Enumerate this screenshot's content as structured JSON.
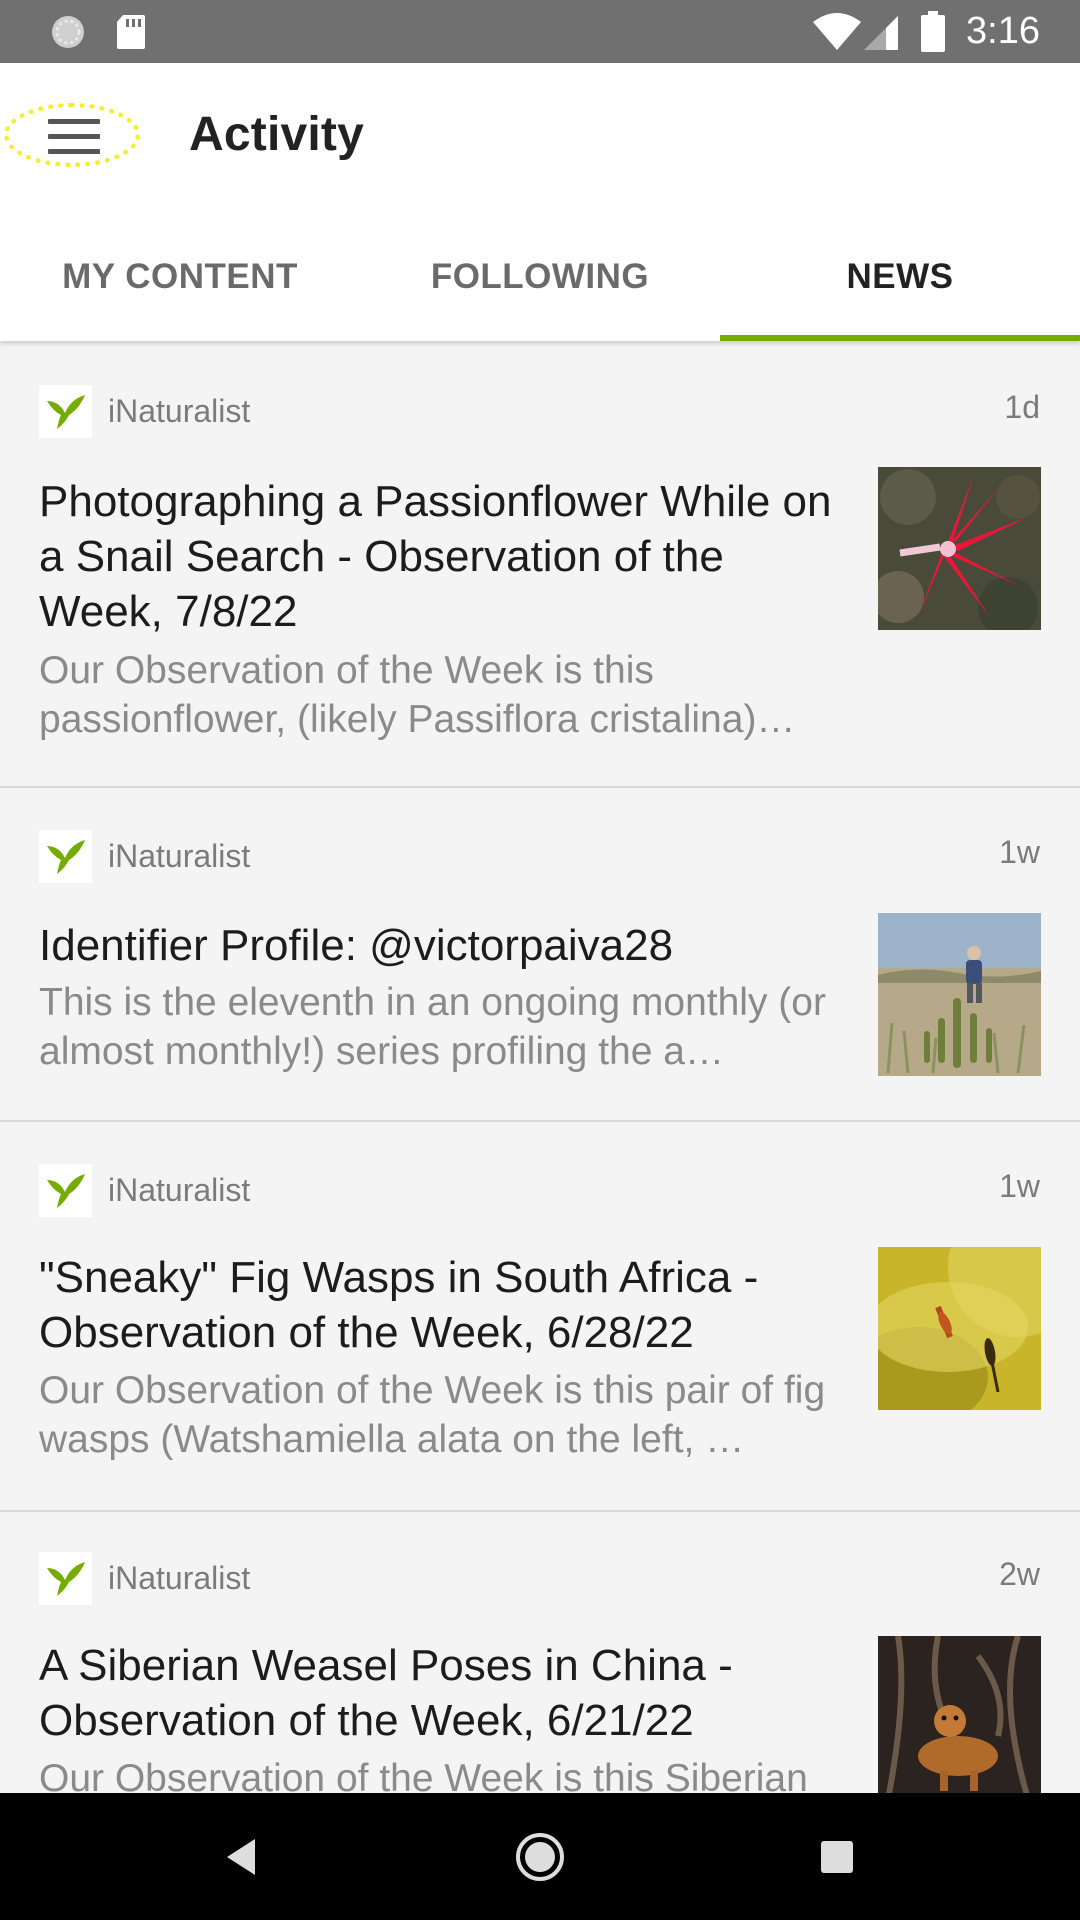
{
  "status_bar": {
    "time": "3:16"
  },
  "app_bar": {
    "title": "Activity"
  },
  "tabs": [
    {
      "label": "MY CONTENT"
    },
    {
      "label": "FOLLOWING"
    },
    {
      "label": "NEWS"
    }
  ],
  "active_tab": "NEWS",
  "accent_color": "#74ac00",
  "news": [
    {
      "source": "iNaturalist",
      "age": "1d",
      "title": "Photographing a Passionflower While on a Snail Search - Observation of the Week, 7/8/22",
      "summary": "Our Observation of the Week is this passionflower, (likely Passiflora cristalina)…",
      "thumbnail": "red passionflower"
    },
    {
      "source": "iNaturalist",
      "age": "1w",
      "title": "Identifier Profile: @victorpaiva28",
      "summary": "This is the eleventh in an ongoing monthly (or almost monthly!) series profiling the a…",
      "thumbnail": "person in dry scrubland with cactus"
    },
    {
      "source": "iNaturalist",
      "age": "1w",
      "title": "\"Sneaky\" Fig Wasps in South Africa - Observation of the Week, 6/28/22",
      "summary": "Our Observation of the Week is this pair of fig wasps (Watshamiella alata on the left, …",
      "thumbnail": "fig wasps on yellow fig"
    },
    {
      "source": "iNaturalist",
      "age": "2w",
      "title": "A Siberian Weasel Poses in China - Observation of the Week, 6/21/22",
      "summary": "Our Observation of the Week is this Siberian",
      "thumbnail": "siberian weasel among roots"
    }
  ]
}
